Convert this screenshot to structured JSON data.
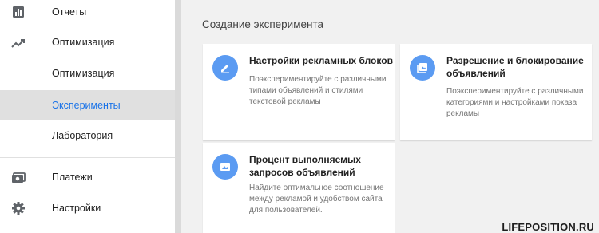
{
  "sidebar": {
    "items": [
      {
        "label": "Отчеты",
        "icon": "bar-chart-icon"
      },
      {
        "label": "Оптимизация",
        "icon": "trending-up-icon"
      },
      {
        "label": "Оптимизация"
      },
      {
        "label": "Эксперименты",
        "active": true
      },
      {
        "label": "Лаборатория"
      },
      {
        "label": "Платежи",
        "icon": "payments-icon"
      },
      {
        "label": "Настройки",
        "icon": "gear-icon"
      }
    ]
  },
  "main": {
    "title": "Создание эксперимента",
    "cards": [
      {
        "title_line1": "Настройки рекламных блоков",
        "title_line2": "",
        "desc_line1": "Поэкспериментируйте с различными",
        "desc_line2": "типами объявлений и стилями",
        "desc_line3": "текстовой рекламы",
        "icon": "pencil-icon"
      },
      {
        "title_line1": "Разрешение и блокирование",
        "title_line2": "объявлений",
        "desc_line1": "Поэкспериментируйте с различными",
        "desc_line2": "категориями и настройками показа",
        "desc_line3": "рекламы",
        "icon": "photo-library-icon"
      },
      {
        "title_line1": "Процент выполняемых",
        "title_line2": "запросов объявлений",
        "desc_line1": "Найдите оптимальное соотношение",
        "desc_line2": "между рекламой и удобством сайта",
        "desc_line3": "для пользователей.",
        "icon": "image-icon"
      }
    ]
  },
  "watermark": "LIFEPOSITION.RU",
  "colors": {
    "accent": "#1a73e8",
    "icon_circle": "#5b9bf2",
    "active_bg": "#e0e0e0"
  }
}
